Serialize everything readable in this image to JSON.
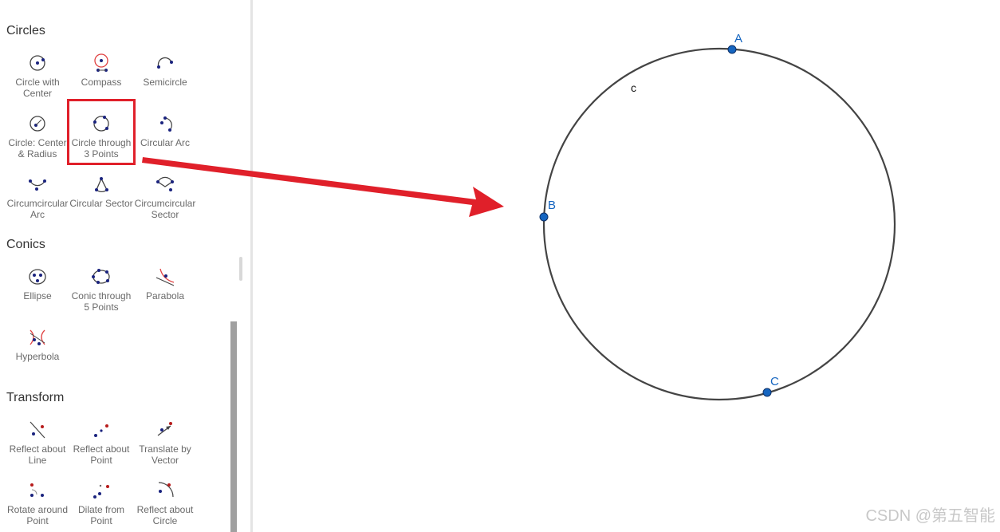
{
  "sidebar": {
    "sections": [
      {
        "title": "Circles",
        "tools": [
          {
            "label": "Circle with\nCenter",
            "icon": "circle-with-center-icon"
          },
          {
            "label": "Compass",
            "icon": "compass-icon"
          },
          {
            "label": "Semicircle",
            "icon": "semicircle-icon"
          },
          {
            "label": "Circle: Center\n& Radius",
            "icon": "circle-center-radius-icon"
          },
          {
            "label": "Circle through\n3 Points",
            "icon": "circle-three-points-icon"
          },
          {
            "label": "Circular Arc",
            "icon": "circular-arc-icon"
          },
          {
            "label": "Circumcircular\nArc",
            "icon": "circumcircular-arc-icon"
          },
          {
            "label": "Circular Sector",
            "icon": "circular-sector-icon"
          },
          {
            "label": "Circumcircular\nSector",
            "icon": "circumcircular-sector-icon"
          }
        ]
      },
      {
        "title": "Conics",
        "tools": [
          {
            "label": "Ellipse",
            "icon": "ellipse-icon"
          },
          {
            "label": "Conic through\n5 Points",
            "icon": "conic-five-points-icon"
          },
          {
            "label": "Parabola",
            "icon": "parabola-icon"
          },
          {
            "label": "Hyperbola",
            "icon": "hyperbola-icon"
          }
        ]
      },
      {
        "title": "Transform",
        "tools": [
          {
            "label": "Reflect about\nLine",
            "icon": "reflect-line-icon"
          },
          {
            "label": "Reflect about\nPoint",
            "icon": "reflect-point-icon"
          },
          {
            "label": "Translate by\nVector",
            "icon": "translate-vector-icon"
          },
          {
            "label": "Rotate around\nPoint",
            "icon": "rotate-point-icon"
          },
          {
            "label": "Dilate from\nPoint",
            "icon": "dilate-point-icon"
          },
          {
            "label": "Reflect about\nCircle",
            "icon": "reflect-circle-icon"
          }
        ]
      }
    ],
    "highlighted_tool": "Circle through\n3 Points"
  },
  "graphics": {
    "circle_label": "c",
    "points": [
      {
        "name": "A"
      },
      {
        "name": "B"
      },
      {
        "name": "C"
      }
    ],
    "colors": {
      "circle": "#444444",
      "point_fill": "#1565c0",
      "point_label": "#1565c0",
      "arrow": "#e0202a"
    }
  },
  "watermark": "CSDN @第五智能"
}
